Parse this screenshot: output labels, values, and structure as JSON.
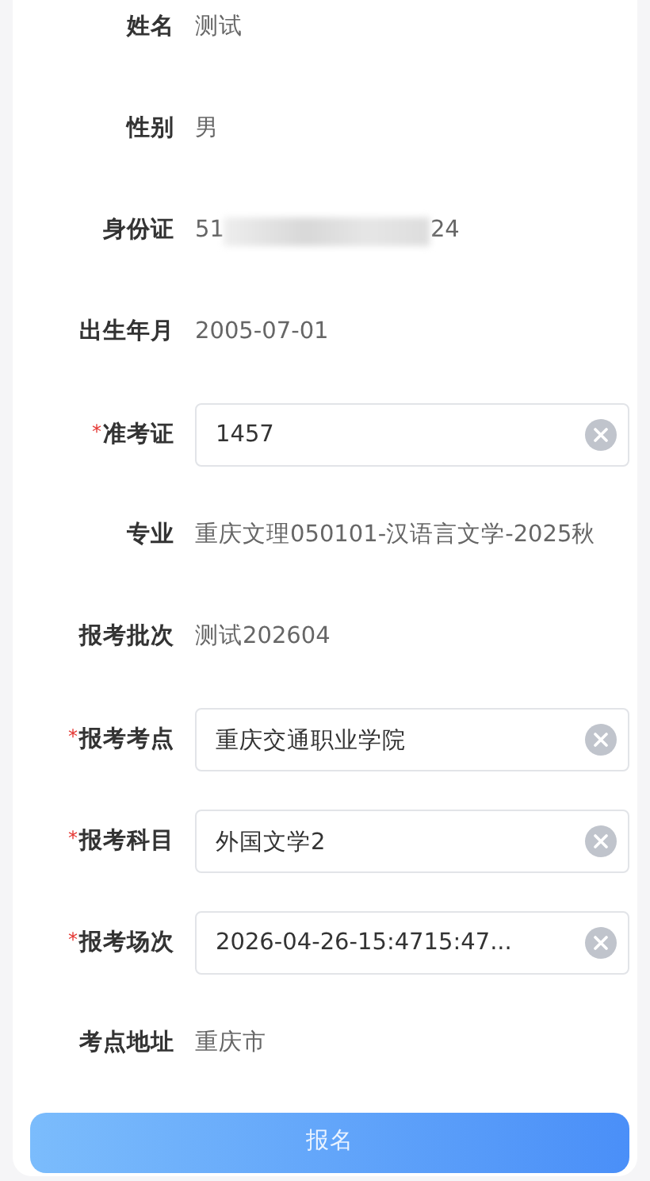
{
  "fields": [
    {
      "kind": "text",
      "label": "姓名",
      "value": "测试"
    },
    {
      "kind": "text",
      "label": "性别",
      "value": "男"
    },
    {
      "kind": "masked",
      "label": "身份证",
      "prefix": "51",
      "suffix": "24"
    },
    {
      "kind": "text",
      "label": "出生年月",
      "value": "2005-07-01"
    },
    {
      "kind": "input",
      "required_mark": "*",
      "label": "准考证",
      "value": "1457",
      "clearable": true
    },
    {
      "kind": "text",
      "label": "专业",
      "value": "重庆文理050101-汉语言文学-2025秋"
    },
    {
      "kind": "text",
      "label": "报考批次",
      "value": "测试202604"
    },
    {
      "kind": "input",
      "required_mark": "*",
      "label": "报考考点",
      "value": "重庆交通职业学院",
      "clearable": true
    },
    {
      "kind": "input",
      "required_mark": "*",
      "label": "报考科目",
      "value": "外国文学2",
      "clearable": true
    },
    {
      "kind": "input",
      "required_mark": "*",
      "label": "报考场次",
      "value": "2026-04-26-15:4715:47...",
      "clearable": true
    },
    {
      "kind": "text",
      "label": "考点地址",
      "value": "重庆市"
    }
  ],
  "submit_button": "报名"
}
